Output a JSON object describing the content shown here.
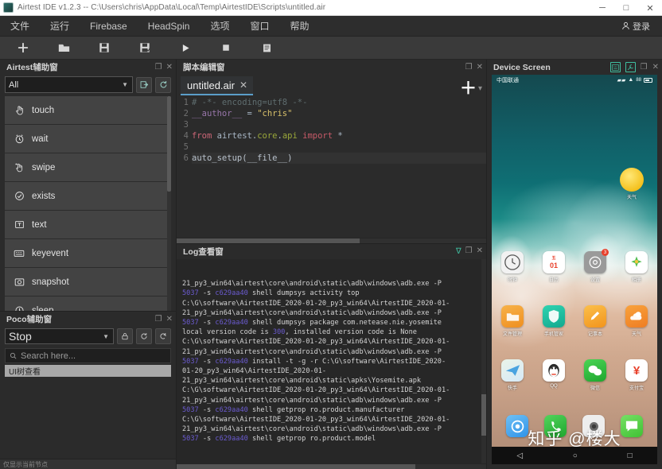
{
  "window": {
    "title": "Airtest IDE v1.2.3 -- C:\\Users\\chris\\AppData\\Local\\Temp\\AirtestIDE\\Scripts\\untitled.air",
    "logo_name": "airtest-logo",
    "minimize": "─",
    "maximize": "□",
    "close": "✕"
  },
  "menubar": {
    "items": [
      {
        "label": "文件",
        "name": "menu-file"
      },
      {
        "label": "运行",
        "name": "menu-run"
      },
      {
        "label": "Firebase",
        "name": "menu-firebase"
      },
      {
        "label": "HeadSpin",
        "name": "menu-headspin"
      },
      {
        "label": "选项",
        "name": "menu-options"
      },
      {
        "label": "窗口",
        "name": "menu-window"
      },
      {
        "label": "帮助",
        "name": "menu-help"
      }
    ],
    "login": {
      "label": "登录",
      "icon": "user-icon"
    }
  },
  "toolbar": {
    "buttons": [
      {
        "name": "new-script-button",
        "icon": "plus-icon",
        "glyph": "＋"
      },
      {
        "name": "open-script-button",
        "icon": "folder-icon",
        "glyph": "📁"
      },
      {
        "name": "save-button",
        "icon": "save-icon",
        "glyph": "💾"
      },
      {
        "name": "save-as-button",
        "icon": "save-as-icon",
        "glyph": "💾"
      },
      {
        "name": "run-button",
        "icon": "play-icon",
        "glyph": "▶"
      },
      {
        "name": "stop-button",
        "icon": "stop-icon",
        "glyph": "■"
      },
      {
        "name": "report-button",
        "icon": "report-icon",
        "glyph": "☰"
      }
    ]
  },
  "airtest_panel": {
    "title": "Airtest辅助窗",
    "float_icon": "❐",
    "close_icon": "✕",
    "filter": {
      "value": "All",
      "caret": "▼"
    },
    "action_buttons": [
      {
        "name": "insert-code-button",
        "glyph": "⇥"
      },
      {
        "name": "refresh-button",
        "glyph": "⟳"
      }
    ],
    "commands": [
      {
        "label": "touch",
        "icon": "hand-touch-icon",
        "glyph": "✋"
      },
      {
        "label": "wait",
        "icon": "clock-icon",
        "glyph": "⏱"
      },
      {
        "label": "swipe",
        "icon": "swipe-icon",
        "glyph": "☝"
      },
      {
        "label": "exists",
        "icon": "check-circle-icon",
        "glyph": "✓"
      },
      {
        "label": "text",
        "icon": "text-input-icon",
        "glyph": "T"
      },
      {
        "label": "keyevent",
        "icon": "keyboard-icon",
        "glyph": "⌨"
      },
      {
        "label": "snapshot",
        "icon": "camera-icon",
        "glyph": "▣"
      },
      {
        "label": "sleep",
        "icon": "moon-icon",
        "glyph": "☽"
      }
    ]
  },
  "poco_panel": {
    "title": "Poco辅助窗",
    "float_icon": "❐",
    "close_icon": "✕",
    "mode": {
      "value": "Stop",
      "caret": "▼"
    },
    "action_buttons": [
      {
        "name": "lock-button",
        "glyph": "🔒"
      },
      {
        "name": "refresh-button",
        "glyph": "⟳"
      },
      {
        "name": "export-button",
        "glyph": "⇥"
      }
    ],
    "search": {
      "placeholder": "Search here...",
      "icon": "search-icon",
      "glyph": "⚲"
    },
    "tree_root": "UI树查看",
    "status": "仅显示当前节点"
  },
  "editor_panel": {
    "title": "脚本编辑窗",
    "float_icon": "❐",
    "close_icon": "✕",
    "tab": {
      "label": "untitled.air",
      "close": "✕"
    },
    "add_tab": "＋",
    "tab_menu": "▾",
    "gutter": [
      "1",
      "2",
      "3",
      "4",
      "5",
      "6"
    ],
    "lines": [
      {
        "n": 1,
        "tokens": [
          {
            "t": "# -*- encoding=utf8 -*-",
            "c": "c-com"
          }
        ]
      },
      {
        "n": 2,
        "tokens": [
          {
            "t": "__author__",
            "c": "c-var"
          },
          {
            "t": " = ",
            "c": "c-op"
          },
          {
            "t": "\"chris\"",
            "c": "c-str"
          }
        ]
      },
      {
        "n": 3,
        "tokens": [
          {
            "t": "",
            "c": "c-op"
          }
        ]
      },
      {
        "n": 4,
        "tokens": [
          {
            "t": "from",
            "c": "c-kw"
          },
          {
            "t": " airtest.",
            "c": "c-op"
          },
          {
            "t": "core",
            "c": "c-mod"
          },
          {
            "t": ".",
            "c": "c-op"
          },
          {
            "t": "api",
            "c": "c-mod"
          },
          {
            "t": " ",
            "c": "c-op"
          },
          {
            "t": "import",
            "c": "c-kw2"
          },
          {
            "t": " *",
            "c": "c-op"
          }
        ]
      },
      {
        "n": 5,
        "tokens": [
          {
            "t": "",
            "c": "c-op"
          }
        ]
      },
      {
        "n": 6,
        "tokens": [
          {
            "t": "auto_setup(__file__)",
            "c": "c-fn"
          }
        ]
      }
    ]
  },
  "log_panel": {
    "title": "Log查看窗",
    "filter_icon": "∇",
    "float_icon": "❐",
    "close_icon": "✕",
    "lines": [
      "21_py3_win64\\airtest\\core\\android\\static\\adb\\windows\\adb.exe -P",
      "5037 -s c629aa40 shell dumpsys activity top",
      "C:\\G\\software\\AirtestIDE_2020-01-20_py3_win64\\AirtestIDE_2020-01-",
      "21_py3_win64\\airtest\\core\\android\\static\\adb\\windows\\adb.exe -P",
      "5037 -s c629aa40 shell dumpsys package com.netease.nie.yosemite",
      "local version code is 300, installed version code is None",
      "C:\\G\\software\\AirtestIDE_2020-01-20_py3_win64\\AirtestIDE_2020-01-",
      "21_py3_win64\\airtest\\core\\android\\static\\adb\\windows\\adb.exe -P",
      "5037 -s c629aa40 install -t -g -r C:\\G\\software\\AirtestIDE_2020-",
      "01-20_py3_win64\\AirtestIDE_2020-01-",
      "21_py3_win64\\airtest\\core\\android\\static\\apks\\Yosemite.apk",
      "C:\\G\\software\\AirtestIDE_2020-01-20_py3_win64\\AirtestIDE_2020-01-",
      "21_py3_win64\\airtest\\core\\android\\static\\adb\\windows\\adb.exe -P",
      "5037 -s c629aa40 shell getprop ro.product.manufacturer",
      "C:\\G\\software\\AirtestIDE_2020-01-20_py3_win64\\AirtestIDE_2020-01-",
      "21_py3_win64\\airtest\\core\\android\\static\\adb\\windows\\adb.exe -P",
      "5037 -s c629aa40 shell getprop ro.product.model"
    ]
  },
  "device_panel": {
    "title": "Device Screen",
    "tools": [
      {
        "name": "device-keyboard-button",
        "glyph": "⌨"
      },
      {
        "name": "device-settings-button",
        "glyph": "⚒"
      }
    ],
    "float_icon": "❐",
    "close_icon": "✕",
    "status_bar": {
      "left": "中国联通",
      "signal": "▰▰",
      "wifi": "▲",
      "battery_pct": "88"
    },
    "sun_widget": {
      "label": "天气"
    },
    "apps_row1": [
      {
        "label": "时钟",
        "icon": "clock-app-icon",
        "glyph": "◷",
        "bg": "#f2f2f2",
        "fg": "#3a3a3a",
        "badge": ""
      },
      {
        "label": "日历",
        "icon": "calendar-app-icon",
        "glyph": "01",
        "bg": "#ffffff",
        "fg": "#e8412c",
        "badge": ""
      },
      {
        "label": "设置",
        "icon": "settings-app-icon",
        "glyph": "⚙",
        "bg": "#9a9a9a",
        "fg": "#ffffff",
        "badge": "3"
      },
      {
        "label": "相册",
        "icon": "gallery-app-icon",
        "glyph": "✸",
        "bg": "#ffffff",
        "fg": "#5cc85c",
        "badge": ""
      }
    ],
    "apps_row2": [
      {
        "label": "文件管理",
        "icon": "files-app-icon",
        "glyph": "◧",
        "bg": "#f4a032",
        "fg": "#ffffff",
        "badge": ""
      },
      {
        "label": "手机管家",
        "icon": "security-app-icon",
        "glyph": "◐",
        "bg": "#1fb8a0",
        "fg": "#ffffff",
        "badge": ""
      },
      {
        "label": "记事本",
        "icon": "notes-app-icon",
        "glyph": "✎",
        "bg": "#f7a828",
        "fg": "#ffffff",
        "badge": ""
      },
      {
        "label": "天气",
        "icon": "weather-app-icon",
        "glyph": "●",
        "bg": "#f08a2e",
        "fg": "#ffffff",
        "badge": ""
      }
    ],
    "apps_row3": [
      {
        "label": "快手",
        "icon": "telegram-app-icon",
        "glyph": "➤",
        "bg": "#e8f2fb",
        "fg": "#3a9ae0",
        "badge": ""
      },
      {
        "label": "QQ",
        "icon": "qq-app-icon",
        "glyph": "🐧",
        "bg": "#ffffff",
        "fg": "#222222",
        "badge": ""
      },
      {
        "label": "微信",
        "icon": "wechat-app-icon",
        "glyph": "●●",
        "bg": "#2fbf3f",
        "fg": "#ffffff",
        "badge": ""
      },
      {
        "label": "支付宝",
        "icon": "alipay-app-icon",
        "glyph": "¥",
        "bg": "#ffffff",
        "fg": "#e8412c",
        "badge": ""
      }
    ],
    "dock": [
      {
        "label": "浏览器",
        "icon": "browser-dock-icon",
        "glyph": "◎",
        "bg": "#3aa0ec",
        "fg": "#ffffff"
      },
      {
        "label": "电话",
        "icon": "phone-dock-icon",
        "glyph": "☎",
        "bg": "#35c03f",
        "fg": "#ffffff"
      },
      {
        "label": "相机",
        "icon": "camera-dock-icon",
        "glyph": "◉",
        "bg": "#e9e9e9",
        "fg": "#4a4a4a"
      },
      {
        "label": "信息",
        "icon": "messages-dock-icon",
        "glyph": "✉",
        "bg": "#5bd24a",
        "fg": "#ffffff"
      }
    ],
    "navbar": [
      {
        "name": "nav-back-icon",
        "glyph": "◁"
      },
      {
        "name": "nav-home-icon",
        "glyph": "○"
      },
      {
        "name": "nav-recent-icon",
        "glyph": "□"
      }
    ],
    "watermark": "知乎 @楼大"
  }
}
